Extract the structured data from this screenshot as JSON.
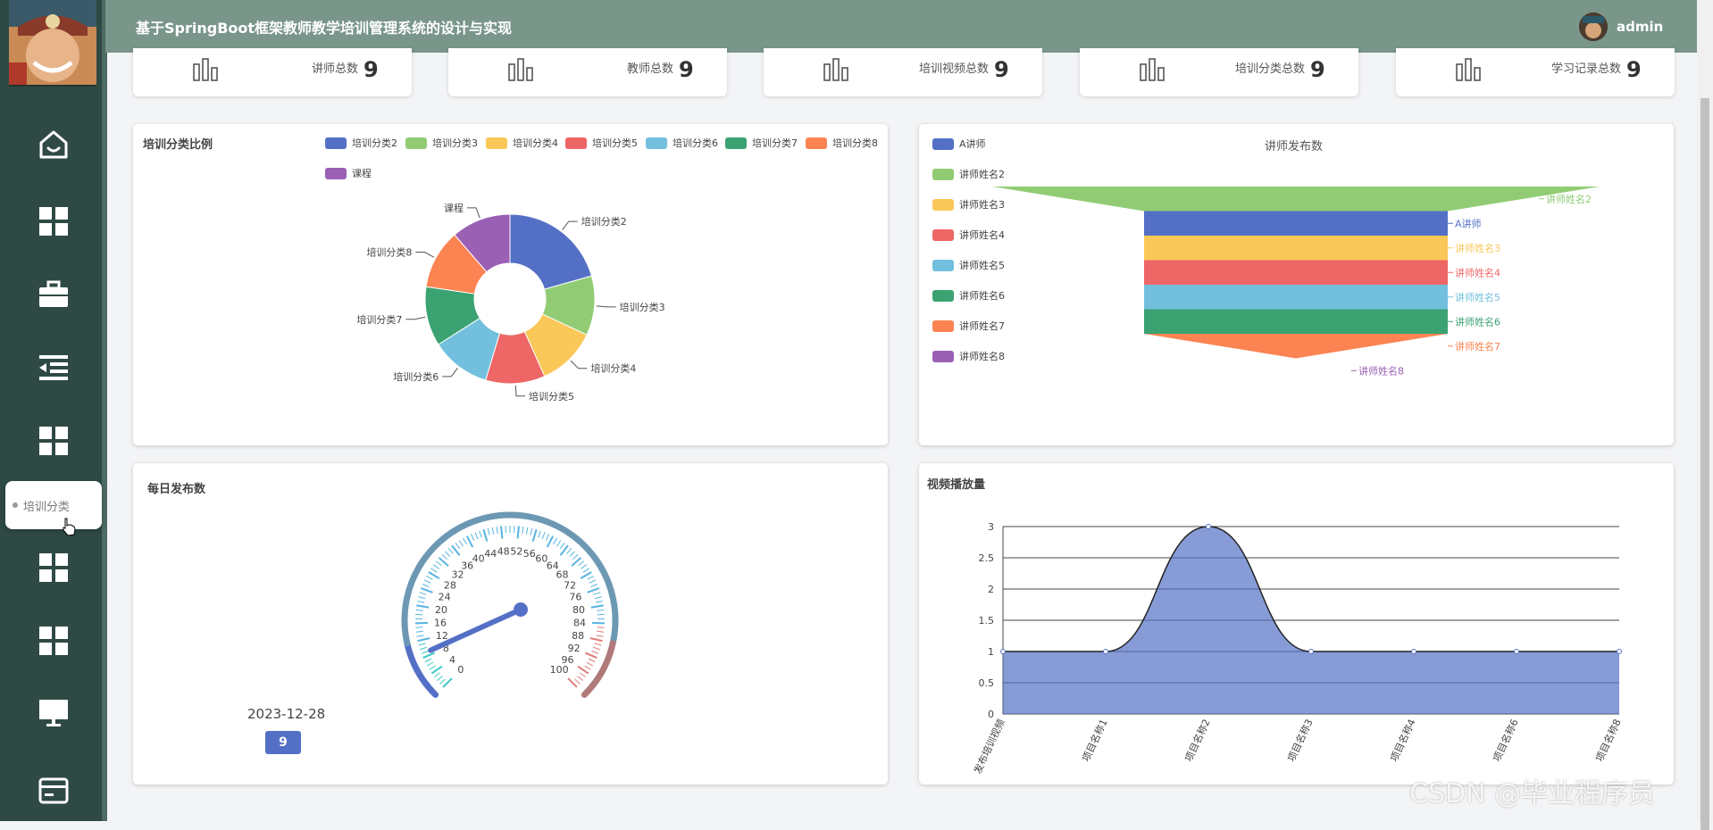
{
  "app": {
    "title": "基于SpringBoot框架教师教学培训管理系统的设计与实现",
    "user": "admin"
  },
  "sidebar": {
    "icons": [
      "home-icon",
      "grid-icon",
      "briefcase-icon",
      "indent-list-icon",
      "grid-icon",
      "grid-icon",
      "grid-icon",
      "monitor-icon",
      "card-icon"
    ],
    "tooltip": "培训分类"
  },
  "stats": [
    {
      "label": "讲师总数",
      "value": "9"
    },
    {
      "label": "教师总数",
      "value": "9"
    },
    {
      "label": "培训视频总数",
      "value": "9"
    },
    {
      "label": "培训分类总数",
      "value": "9"
    },
    {
      "label": "学习记录总数",
      "value": "9"
    }
  ],
  "colors": [
    "#5470c6",
    "#91cc75",
    "#fac858",
    "#ee6666",
    "#73c0de",
    "#3ba272",
    "#fc8452",
    "#9a60b4"
  ],
  "pie_card": {
    "title": "培训分类比例"
  },
  "funnel_card": {
    "title": "讲师发布数"
  },
  "gauge_card": {
    "title": "每日发布数",
    "date": "2023-12-28",
    "value_label": "9"
  },
  "line_card": {
    "title": "视频播放量"
  },
  "watermark": "CSDN @毕业程序员",
  "chart_data": [
    {
      "type": "pie",
      "title": "培训分类比例",
      "legend": [
        "培训分类2",
        "培训分类3",
        "培训分类4",
        "培训分类5",
        "培训分类6",
        "培训分类7",
        "培训分类8",
        "课程"
      ],
      "slices": [
        {
          "name": "培训分类2",
          "value": 1
        },
        {
          "name": "培训分类3",
          "value": 0.55
        },
        {
          "name": "培训分类4",
          "value": 0.55
        },
        {
          "name": "培训分类5",
          "value": 0.55
        },
        {
          "name": "培训分类6",
          "value": 0.55
        },
        {
          "name": "培训分类7",
          "value": 0.55
        },
        {
          "name": "培训分类8",
          "value": 0.55
        },
        {
          "name": "课程",
          "value": 0.55
        }
      ]
    },
    {
      "type": "funnel",
      "title": "讲师发布数",
      "legend": [
        "A讲师",
        "讲师姓名2",
        "讲师姓名3",
        "讲师姓名4",
        "讲师姓名5",
        "讲师姓名6",
        "讲师姓名7",
        "讲师姓名8"
      ],
      "order": [
        "讲师姓名2",
        "A讲师",
        "讲师姓名3",
        "讲师姓名4",
        "讲师姓名5",
        "讲师姓名6",
        "讲师姓名7",
        "讲师姓名8"
      ],
      "values": {
        "讲师姓名2": 2,
        "A讲师": 1,
        "讲师姓名3": 1,
        "讲师姓名4": 1,
        "讲师姓名5": 1,
        "讲师姓名6": 1,
        "讲师姓名7": 1,
        "讲师姓名8": 0
      }
    },
    {
      "type": "gauge",
      "title": "每日发布数",
      "min": 0,
      "max": 100,
      "ticks": [
        "0",
        "4",
        "8",
        "12",
        "16",
        "20",
        "24",
        "28",
        "32",
        "36",
        "40",
        "44",
        "48",
        "52",
        "56",
        "60",
        "64",
        "68",
        "72",
        "76",
        "80",
        "84",
        "88",
        "92",
        "96",
        "100"
      ],
      "value": 9,
      "label": "2023-12-28"
    },
    {
      "type": "area",
      "title": "视频播放量",
      "categories": [
        "发布培训视频",
        "项目名称1",
        "项目名称2",
        "项目名称3",
        "项目名称4",
        "项目名称6",
        "项目名称8"
      ],
      "values": [
        1,
        1,
        3,
        1,
        1,
        1,
        1
      ],
      "ylim": [
        0,
        3
      ],
      "yticks": [
        "0",
        "0.5",
        "1",
        "1.5",
        "2",
        "2.5",
        "3"
      ],
      "grid": true
    }
  ]
}
